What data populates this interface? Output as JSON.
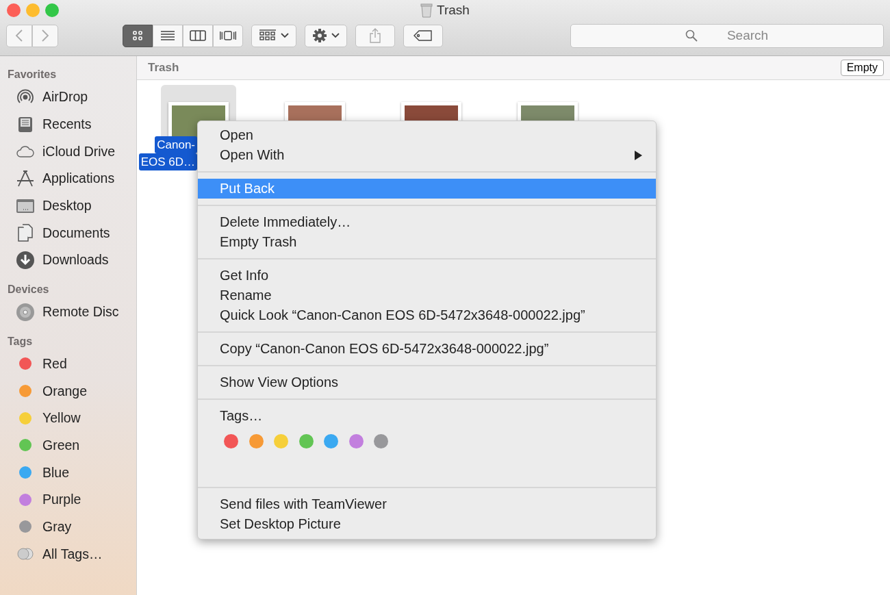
{
  "window": {
    "title": "Trash"
  },
  "toolbar": {
    "views": [
      {
        "kind": "icon",
        "selected": true
      },
      {
        "kind": "list",
        "selected": false
      },
      {
        "kind": "column",
        "selected": false
      },
      {
        "kind": "coverflow",
        "selected": false
      }
    ]
  },
  "search": {
    "placeholder": "Search"
  },
  "sidebar": {
    "sections": [
      {
        "title": "Favorites",
        "items": [
          {
            "label": "AirDrop",
            "kind": "airdrop"
          },
          {
            "label": "Recents",
            "kind": "recents"
          },
          {
            "label": "iCloud Drive",
            "kind": "cloud"
          },
          {
            "label": "Applications",
            "kind": "apps"
          },
          {
            "label": "Desktop",
            "kind": "desktop"
          },
          {
            "label": "Documents",
            "kind": "documents"
          },
          {
            "label": "Downloads",
            "kind": "downloads"
          }
        ]
      },
      {
        "title": "Devices",
        "items": [
          {
            "label": "Remote Disc",
            "kind": "disc"
          }
        ]
      },
      {
        "title": "Tags",
        "items": [
          {
            "label": "Red",
            "kind": "tag",
            "color": "#f25656"
          },
          {
            "label": "Orange",
            "kind": "tag",
            "color": "#f79a36"
          },
          {
            "label": "Yellow",
            "kind": "tag",
            "color": "#f6cf3a"
          },
          {
            "label": "Green",
            "kind": "tag",
            "color": "#62c554"
          },
          {
            "label": "Blue",
            "kind": "tag",
            "color": "#3ba9f1"
          },
          {
            "label": "Purple",
            "kind": "tag",
            "color": "#c27fde"
          },
          {
            "label": "Gray",
            "kind": "tag",
            "color": "#98989b"
          },
          {
            "label": "All Tags…",
            "kind": "alltags"
          }
        ]
      }
    ]
  },
  "path_bar": {
    "title": "Trash",
    "button": "Empty"
  },
  "files": [
    {
      "selected": true,
      "label_lines": [
        "Canon-",
        "EOS 6D…"
      ],
      "color": "#7a8a5a"
    },
    {
      "selected": false,
      "color": "#a8705c"
    },
    {
      "selected": false,
      "color": "#8a4a3a"
    },
    {
      "selected": false,
      "color": "#7d8a6a"
    }
  ],
  "context_menu": {
    "groups": [
      {
        "items": [
          {
            "label": "Open",
            "selected": false,
            "submenu": false
          },
          {
            "label": "Open With",
            "selected": false,
            "submenu": true
          }
        ]
      },
      {
        "items": [
          {
            "label": "Put Back",
            "selected": true,
            "submenu": false
          }
        ]
      },
      {
        "items": [
          {
            "label": "Delete Immediately…",
            "selected": false,
            "submenu": false
          },
          {
            "label": "Empty Trash",
            "selected": false,
            "submenu": false
          }
        ]
      },
      {
        "items": [
          {
            "label": "Get Info",
            "selected": false,
            "submenu": false
          },
          {
            "label": "Rename",
            "selected": false,
            "submenu": false
          },
          {
            "label": "Quick Look “Canon-Canon EOS 6D-5472x3648-000022.jpg”",
            "selected": false,
            "submenu": false
          }
        ]
      },
      {
        "items": [
          {
            "label": "Copy “Canon-Canon EOS 6D-5472x3648-000022.jpg”",
            "selected": false,
            "submenu": false
          }
        ]
      },
      {
        "items": [
          {
            "label": "Show View Options",
            "selected": false,
            "submenu": false
          }
        ]
      },
      {
        "items": [
          {
            "label": "Tags…",
            "selected": false,
            "submenu": false
          }
        ],
        "tag_colors": [
          {
            "color": "#f25656"
          },
          {
            "color": "#f79a36"
          },
          {
            "color": "#f6cf3a"
          },
          {
            "color": "#62c554"
          },
          {
            "color": "#3ba9f1"
          },
          {
            "color": "#c27fde"
          },
          {
            "color": "#98989b"
          }
        ]
      },
      {
        "items": [
          {
            "label": "Send files with TeamViewer",
            "selected": false,
            "submenu": false
          },
          {
            "label": "Set Desktop Picture",
            "selected": false,
            "submenu": false
          }
        ]
      }
    ]
  }
}
